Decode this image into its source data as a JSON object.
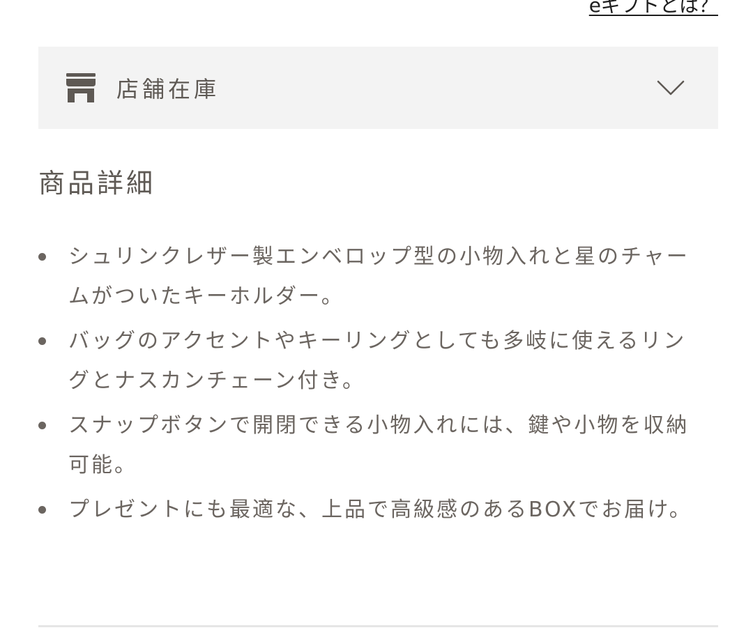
{
  "gift_link": {
    "label": "eギフトとは？"
  },
  "store_stock": {
    "icon": "store-icon",
    "label": "店舗在庫",
    "toggle_icon": "chevron-down-icon"
  },
  "details": {
    "title": "商品詳細",
    "items": [
      "シュリンクレザー製エンベロップ型の小物入れと星のチャームがついたキーホルダー。",
      "バッグのアクセントやキーリングとしても多岐に使えるリングとナスカンチェーン付き。",
      "スナップボタンで開閉できる小物入れには、鍵や小物を収納可能。",
      "プレゼントにも最適な、上品で高級感のあるBOXでお届け。"
    ]
  },
  "colors": {
    "panel_bg": "#f3f3f3",
    "text": "#6b6560",
    "icon": "#5e5954"
  }
}
